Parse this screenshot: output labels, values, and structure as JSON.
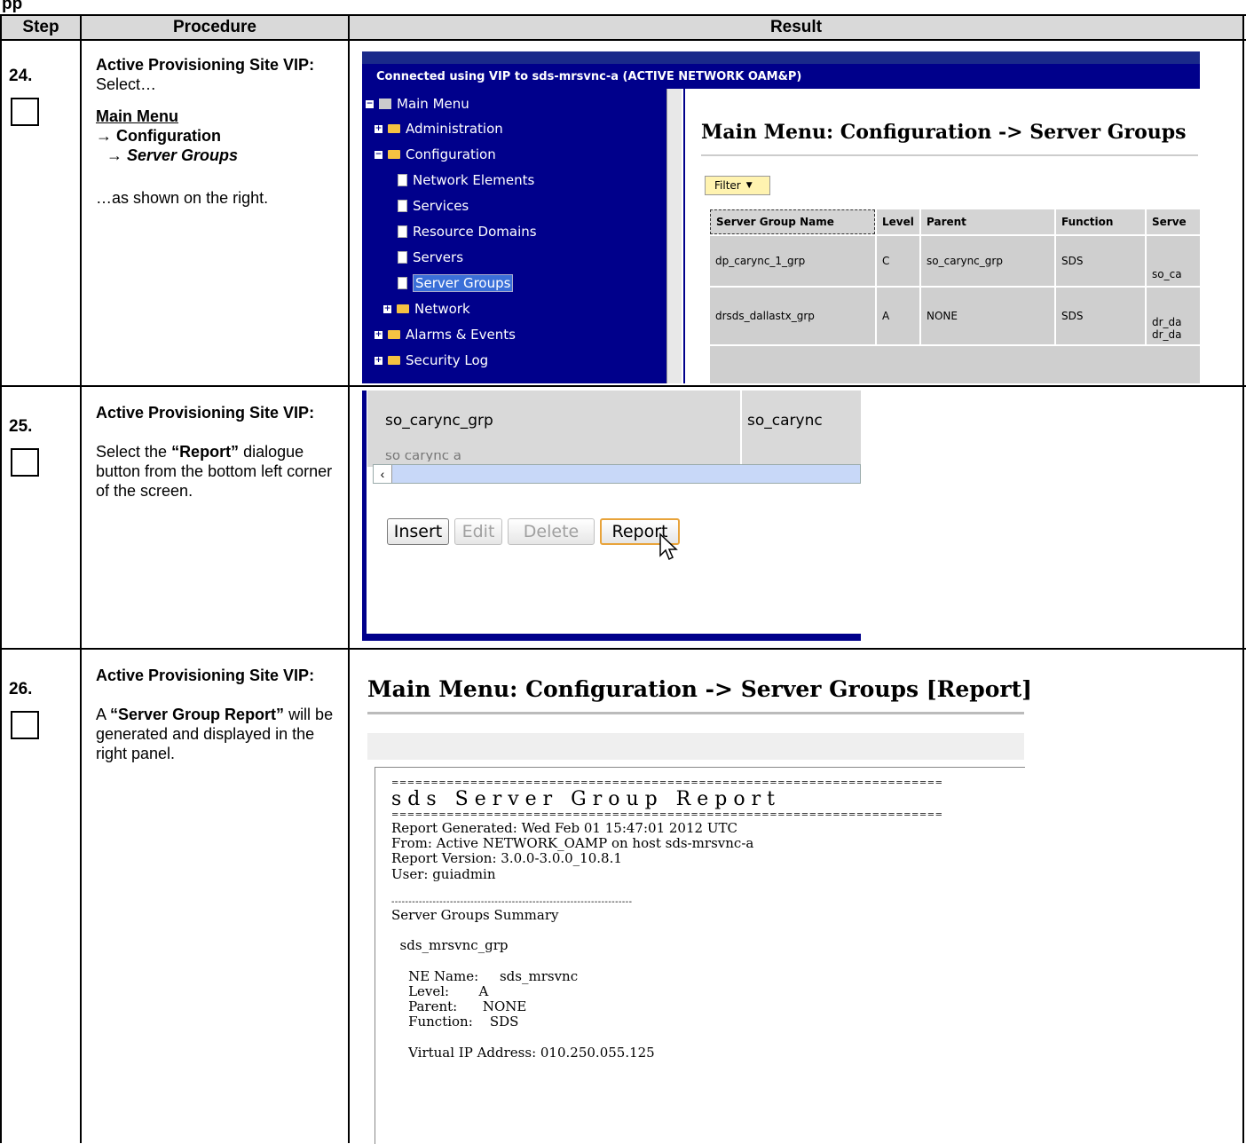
{
  "top_left_fragment": "pp",
  "headers": {
    "step": "Step",
    "procedure": "Procedure",
    "result": "Result"
  },
  "steps": [
    {
      "number": "24.",
      "title": "Active Provisioning Site VIP:",
      "text1": "Select…",
      "menu_path": [
        "Main Menu",
        "→ Configuration",
        "→ Server Groups"
      ],
      "text2": "…as shown on the right."
    },
    {
      "number": "25.",
      "title": "Active Provisioning Site VIP:",
      "text_pre": "Select the ",
      "bold": "“Report”",
      "text_post": " dialogue button from the bottom left corner of the screen."
    },
    {
      "number": "26.",
      "title": "Active Provisioning Site VIP:",
      "text_pre": "A ",
      "bold": "“Server Group Report”",
      "text_post": " will be generated and displayed in the right panel."
    }
  ],
  "screenshot24": {
    "connection_banner": "Connected using VIP to sds-mrsvnc-a (ACTIVE NETWORK OAM&P)",
    "tree": [
      "Main Menu",
      "Administration",
      "Configuration",
      "Network Elements",
      "Services",
      "Resource Domains",
      "Servers",
      "Server Groups",
      "Network",
      "Alarms & Events",
      "Security Log"
    ],
    "page_title": "Main Menu: Configuration -> Server Groups",
    "filter_label": "Filter",
    "columns": [
      "Server Group Name",
      "Level",
      "Parent",
      "Function",
      "Serve"
    ],
    "rows": [
      [
        "dp_carync_1_grp",
        "C",
        "so_carync_grp",
        "SDS",
        "so_ca"
      ],
      [
        "drsds_dallastx_grp",
        "A",
        "NONE",
        "SDS",
        "dr_da",
        "dr_da"
      ]
    ]
  },
  "screenshot25": {
    "row_name": "so_carync_grp",
    "row_ne": "so_carync",
    "row_partial": "so carync a",
    "buttons": [
      "Insert",
      "Edit",
      "Delete",
      "Report"
    ]
  },
  "screenshot26": {
    "title": "Main Menu: Configuration -> Server Groups [Report]",
    "report_lines": [
      "======================================================================",
      "s d s   S e r v e r   G r o u p   R e p o r t",
      "======================================================================",
      "Report Generated: Wed Feb 01 15:47:01 2012 UTC",
      "From: Active NETWORK_OAMP on host sds-mrsvnc-a",
      "Report Version: 3.0.0-3.0.0_10.8.1",
      "User: guiadmin",
      "",
      "----------------------------------------------------------------------",
      "Server Groups Summary",
      "",
      "  sds_mrsvnc_grp",
      "",
      "    NE Name:     sds_mrsvnc",
      "    Level:       A",
      "    Parent:      NONE",
      "    Function:    SDS",
      "",
      "    Virtual IP Address: 010.250.055.125"
    ]
  }
}
